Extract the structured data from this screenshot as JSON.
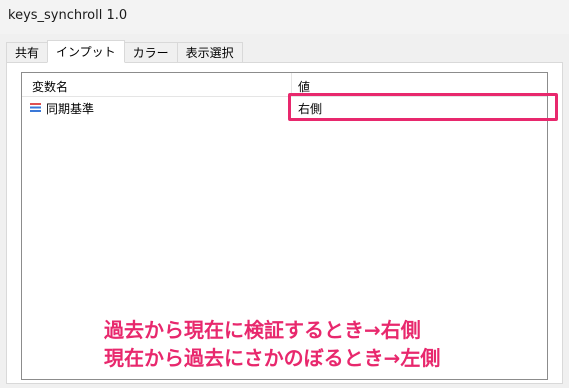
{
  "window": {
    "title": "keys_synchroll 1.0"
  },
  "tabs": [
    {
      "label": "共有",
      "active": false
    },
    {
      "label": "インプット",
      "active": true
    },
    {
      "label": "カラー",
      "active": false
    },
    {
      "label": "表示選択",
      "active": false
    }
  ],
  "table": {
    "columns": [
      "変数名",
      "値"
    ],
    "rows": [
      {
        "icon": "parameter-icon",
        "name": "同期基準",
        "value": "右側"
      }
    ]
  },
  "annotation": {
    "line1": "過去から現在に検証するとき→右側",
    "line2": "現在から過去にさかのぼるとき→左側",
    "color": "#e8286d"
  }
}
